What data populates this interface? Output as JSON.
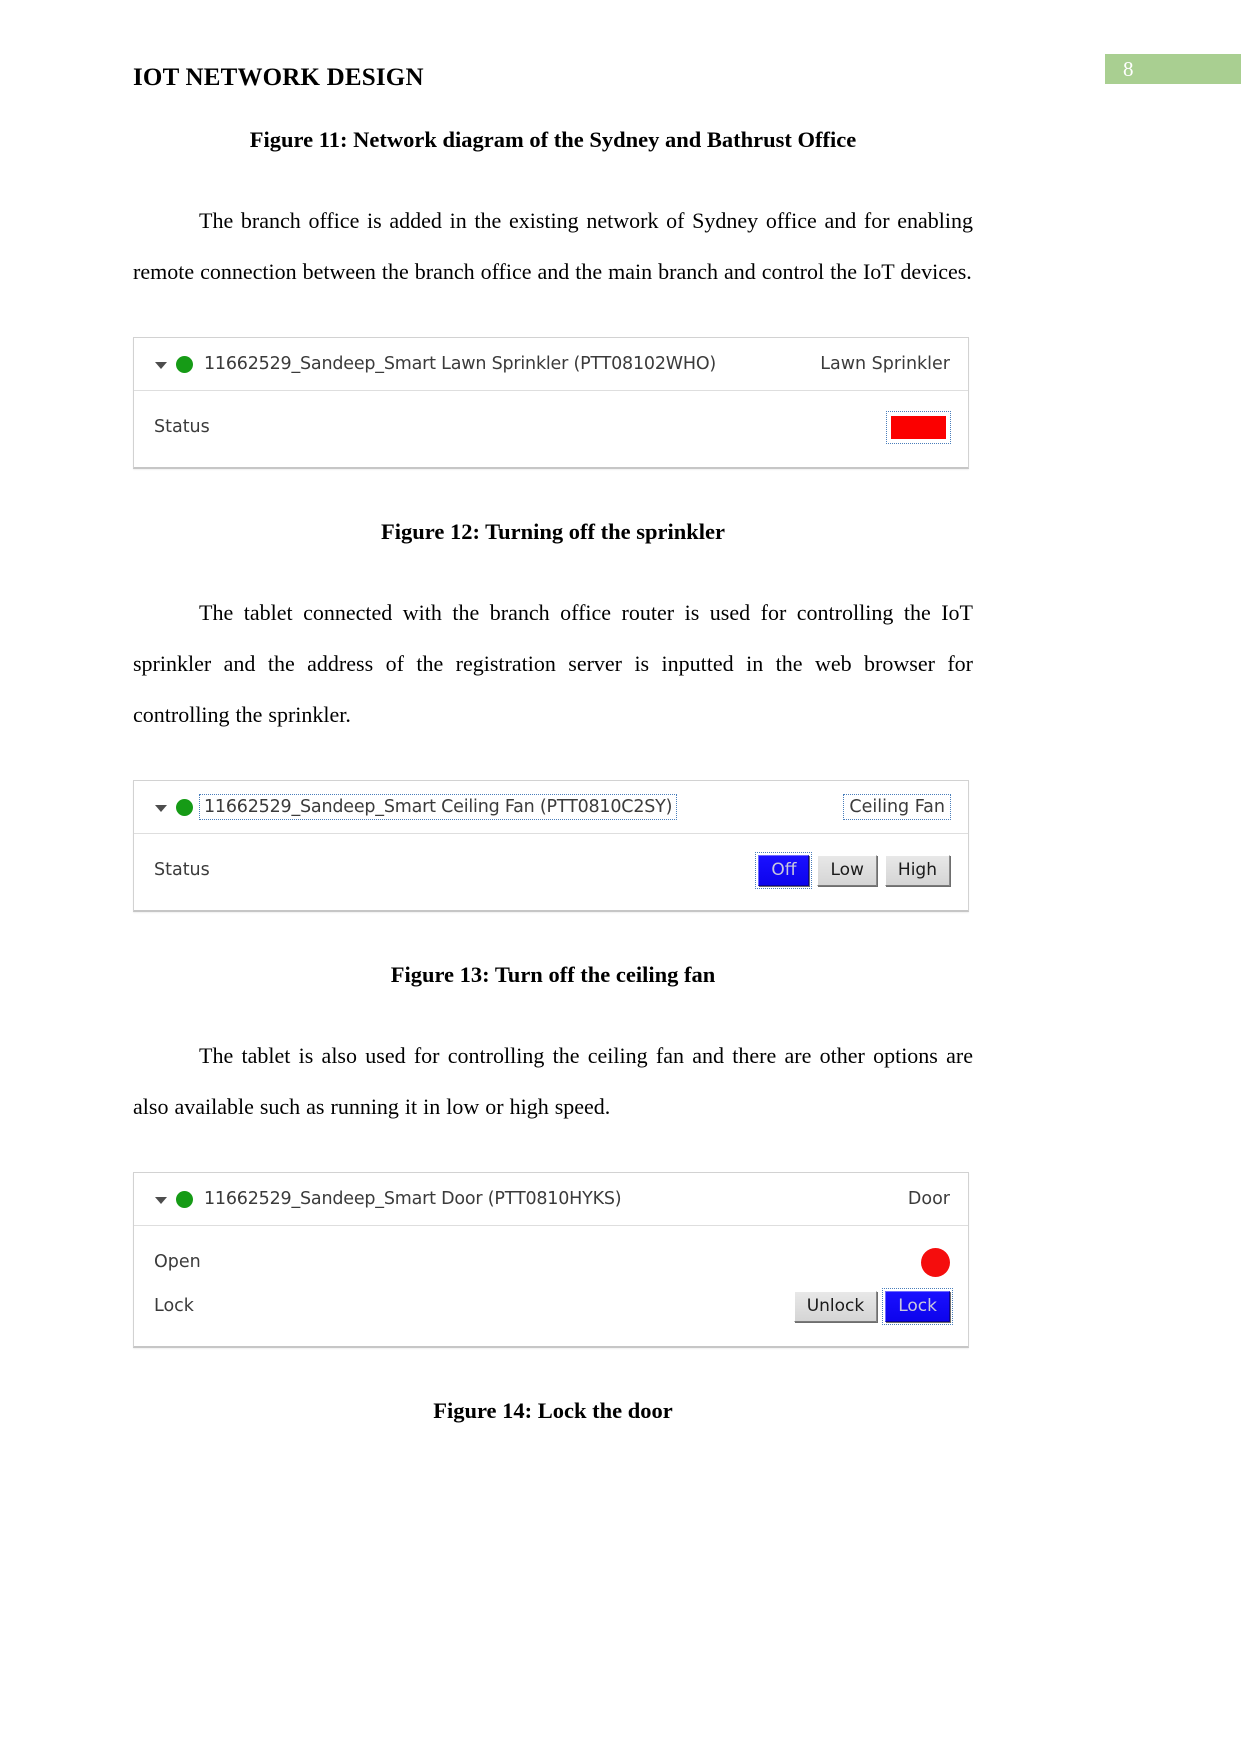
{
  "header": {
    "title": "IOT NETWORK DESIGN",
    "page_number": "8",
    "page_number_bg": "#a9cf91"
  },
  "captions": {
    "figure_11": "Figure 11: Network diagram of the Sydney and Bathrust Office",
    "figure_12": "Figure 12: Turning off the sprinkler",
    "figure_13": "Figure 13: Turn off the ceiling fan",
    "figure_14": "Figure 14: Lock the door"
  },
  "paragraphs": {
    "p1": "The branch office is added in the existing network of Sydney office and for enabling remote connection between the branch office and the main branch and control the IoT devices.",
    "p2": "The tablet connected with the branch office router is used for controlling the IoT sprinkler and the address of the registration server is inputted in the web browser for controlling the sprinkler.",
    "p3": "The tablet is also used for controlling the ceiling fan and there are other options are also available such as running it in low or high speed."
  },
  "widgets": {
    "sprinkler": {
      "title": "11662529_Sandeep_Smart Lawn Sprinkler (PTT08102WHO)",
      "type_label": "Lawn Sprinkler",
      "status_label": "Status",
      "indicator_color": "#fb0000",
      "online_dot_color": "#169b16"
    },
    "ceiling_fan": {
      "title": "11662529_Sandeep_Smart Ceiling Fan (PTT0810C2SY)",
      "type_label": "Ceiling Fan",
      "status_label": "Status",
      "online_dot_color": "#169b16",
      "buttons": [
        {
          "label": "Off",
          "active": true
        },
        {
          "label": "Low",
          "active": false
        },
        {
          "label": "High",
          "active": false
        }
      ]
    },
    "door": {
      "title": "11662529_Sandeep_Smart Door (PTT0810HYKS)",
      "type_label": "Door",
      "open_label": "Open",
      "lock_label": "Lock",
      "indicator_color": "#f50d0d",
      "online_dot_color": "#169b16",
      "buttons": [
        {
          "label": "Unlock",
          "active": false
        },
        {
          "label": "Lock",
          "active": true
        }
      ]
    }
  }
}
